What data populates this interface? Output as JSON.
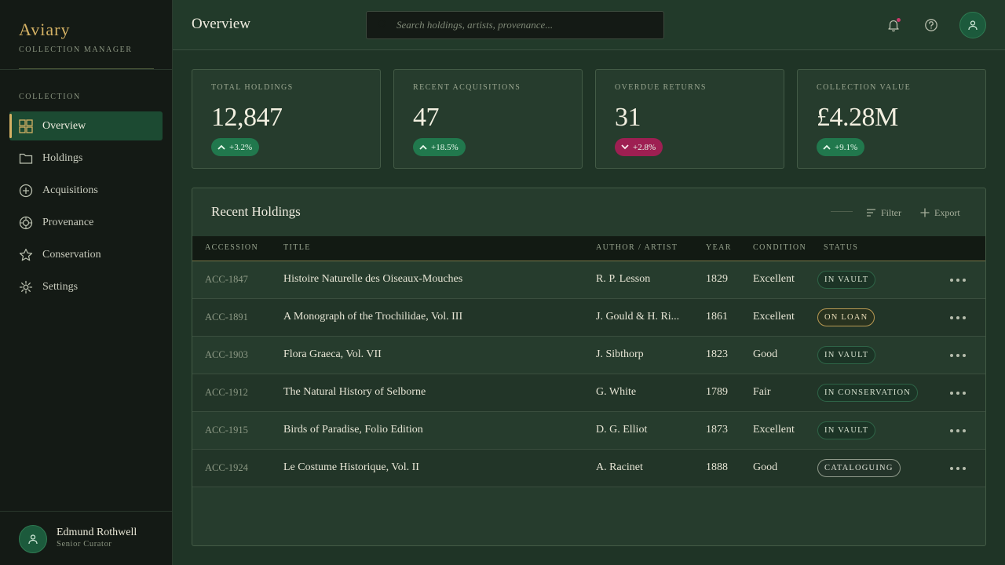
{
  "app": {
    "name": "Aviary",
    "subtitle": "COLLECTION MANAGER"
  },
  "sidebar": {
    "section_label": "COLLECTION",
    "items": [
      {
        "label": "Overview",
        "icon": "grid-icon",
        "active": true
      },
      {
        "label": "Holdings",
        "icon": "folder-icon",
        "active": false
      },
      {
        "label": "Acquisitions",
        "icon": "plus-circle-icon",
        "active": false
      },
      {
        "label": "Provenance",
        "icon": "target-icon",
        "active": false
      },
      {
        "label": "Conservation",
        "icon": "star-icon",
        "active": false
      },
      {
        "label": "Settings",
        "icon": "gear-icon",
        "active": false
      }
    ],
    "user": {
      "name": "Edmund Rothwell",
      "role": "Senior Curator"
    }
  },
  "header": {
    "title": "Overview",
    "search_placeholder": "Search holdings, artists, provenance..."
  },
  "stats": [
    {
      "label": "TOTAL HOLDINGS",
      "value": "12,847",
      "change": "+3.2%",
      "direction": "up"
    },
    {
      "label": "RECENT ACQUISITIONS",
      "value": "47",
      "change": "+18.5%",
      "direction": "up"
    },
    {
      "label": "OVERDUE RETURNS",
      "value": "31",
      "change": "+2.8%",
      "direction": "down"
    },
    {
      "label": "COLLECTION VALUE",
      "value": "£4.28M",
      "change": "+9.1%",
      "direction": "up"
    }
  ],
  "table": {
    "title": "Recent Holdings",
    "filter_label": "Filter",
    "export_label": "Export",
    "columns": [
      "ACCESSION",
      "TITLE",
      "AUTHOR / ARTIST",
      "YEAR",
      "CONDITION",
      "STATUS"
    ],
    "rows": [
      {
        "accession": "ACC-1847",
        "title": "Histoire Naturelle des Oiseaux-Mouches",
        "author": "R. P. Lesson",
        "year": "1829",
        "condition": "Excellent",
        "status": "IN VAULT",
        "status_type": "vault"
      },
      {
        "accession": "ACC-1891",
        "title": "A Monograph of the Trochilidae, Vol. III",
        "author": "J. Gould & H. Ri...",
        "year": "1861",
        "condition": "Excellent",
        "status": "ON LOAN",
        "status_type": "loan"
      },
      {
        "accession": "ACC-1903",
        "title": "Flora Graeca, Vol. VII",
        "author": "J. Sibthorp",
        "year": "1823",
        "condition": "Good",
        "status": "IN VAULT",
        "status_type": "vault"
      },
      {
        "accession": "ACC-1912",
        "title": "The Natural History of Selborne",
        "author": "G. White",
        "year": "1789",
        "condition": "Fair",
        "status": "IN CONSERVATION",
        "status_type": "conservation"
      },
      {
        "accession": "ACC-1915",
        "title": "Birds of Paradise, Folio Edition",
        "author": "D. G. Elliot",
        "year": "1873",
        "condition": "Excellent",
        "status": "IN VAULT",
        "status_type": "vault"
      },
      {
        "accession": "ACC-1924",
        "title": "Le Costume Historique, Vol. II",
        "author": "A. Racinet",
        "year": "1888",
        "condition": "Good",
        "status": "CATALOGUING",
        "status_type": "cataloguing"
      }
    ]
  },
  "colors": {
    "accent_gold": "#d4b164",
    "positive": "#21784d",
    "negative": "#9e1f52",
    "sidebar_bg": "#141a15",
    "main_bg": "#1f3426"
  }
}
